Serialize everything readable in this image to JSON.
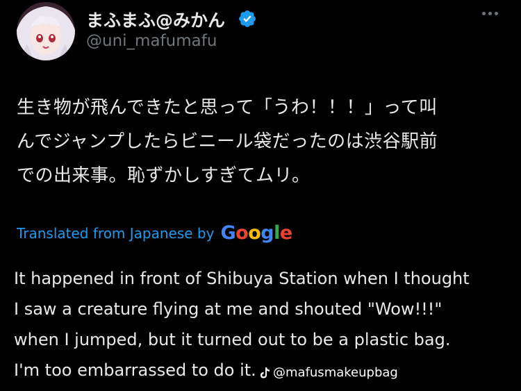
{
  "header": {
    "display_name": "まふまふ@みかん",
    "handle": "@uni_mafumafu",
    "verified": true
  },
  "tweet": {
    "text_jp_lines": [
      "生き物が飛んできたと思って「うわ！！！」って叫",
      "んでジャンプしたらビニール袋だったのは渋谷駅前",
      "での出来事。恥ずかしすぎてムリ。"
    ],
    "translated_label": "Translated from Japanese by",
    "translator_logo": "Google",
    "text_en_lines": [
      "It happened in front of Shibuya Station when I thought",
      "I saw a creature flying at me and shouted \"Wow!!!\"",
      "when I jumped, but it turned out to be a plastic bag.",
      "I'm too embarrassed to do it."
    ]
  },
  "watermark": {
    "icon": "tiktok-icon",
    "text": "@mafusmakeupbag"
  },
  "colors": {
    "background": "#000000",
    "text": "#e7e9ea",
    "secondary": "#71767b",
    "link": "#1d9bf0",
    "verified": "#1d9bf0"
  }
}
